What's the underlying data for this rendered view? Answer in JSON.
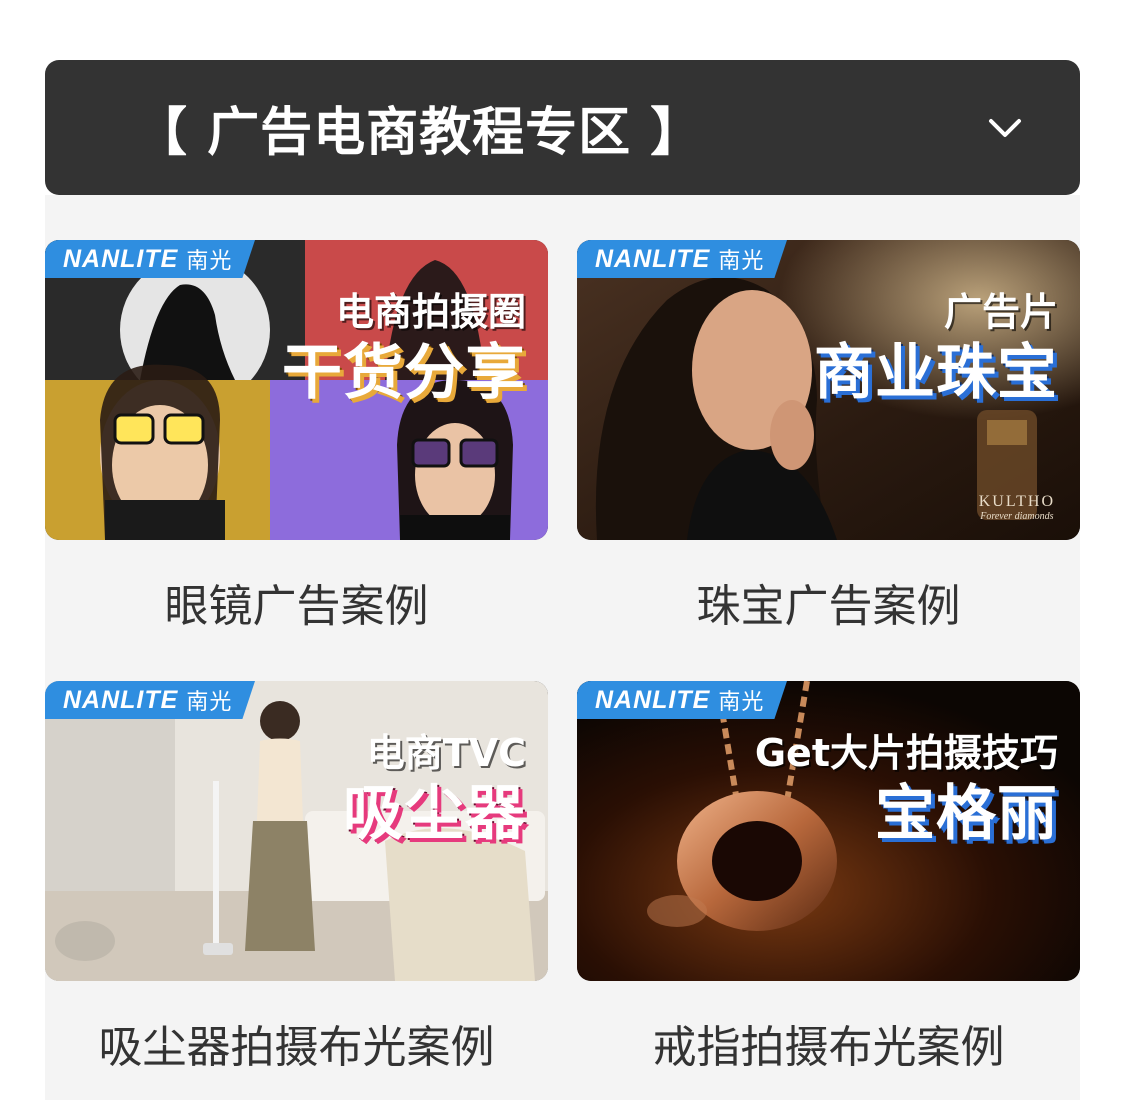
{
  "header": {
    "title": "【 广告电商教程专区 】"
  },
  "brand": {
    "en": "NANLITE",
    "cn": "南光"
  },
  "cards": [
    {
      "overlay_small": "电商拍摄圈",
      "overlay_big": "干货分享",
      "caption": "眼镜广告案例"
    },
    {
      "overlay_small": "广告片",
      "overlay_big": "商业珠宝",
      "caption": "珠宝广告案例",
      "logo": "KULTHO",
      "logo_sub": "Forever diamonds"
    },
    {
      "overlay_small": "电商TVC",
      "overlay_big": "吸尘器",
      "caption": "吸尘器拍摄布光案例"
    },
    {
      "overlay_small": "Get大片拍摄技巧",
      "overlay_big": "宝格丽",
      "caption": "戒指拍摄布光案例"
    }
  ]
}
